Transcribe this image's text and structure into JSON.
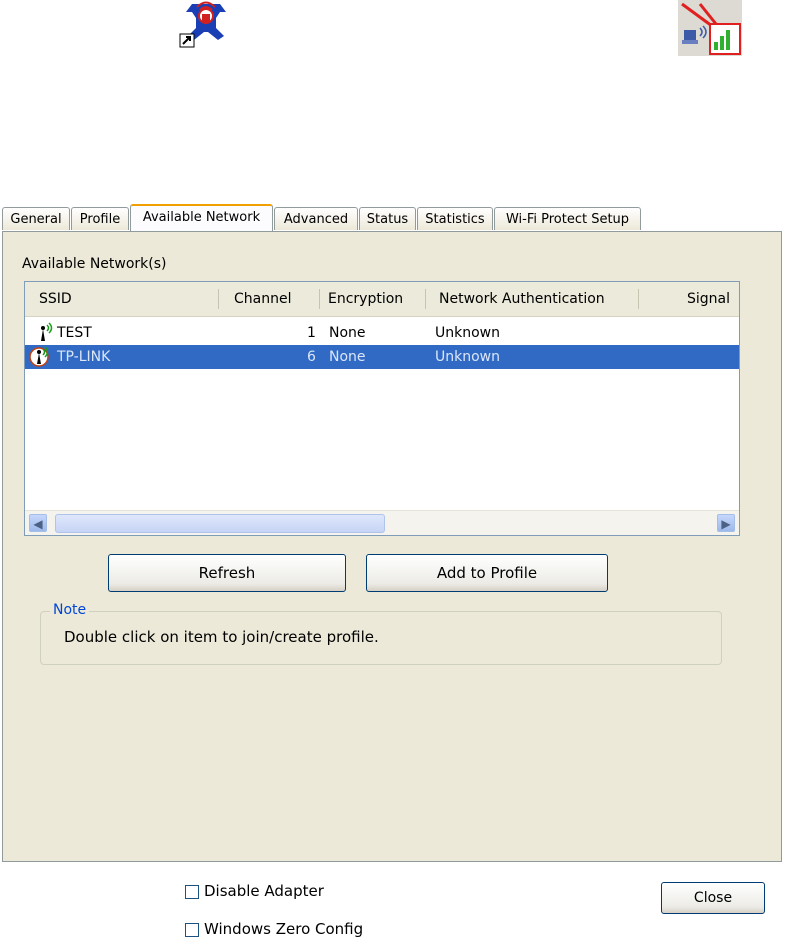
{
  "tabs": [
    {
      "label": "General"
    },
    {
      "label": "Profile"
    },
    {
      "label": "Available Network"
    },
    {
      "label": "Advanced"
    },
    {
      "label": "Status"
    },
    {
      "label": "Statistics"
    },
    {
      "label": "Wi-Fi Protect Setup"
    }
  ],
  "available_label": "Available Network(s)",
  "columns": {
    "ssid": "SSID",
    "channel": "Channel",
    "encryption": "Encryption",
    "auth": "Network Authentication",
    "signal": "Signal"
  },
  "networks": [
    {
      "ssid": "TEST",
      "channel": "1",
      "encryption": "None",
      "auth": "Unknown",
      "selected": false
    },
    {
      "ssid": "TP-LINK",
      "channel": "6",
      "encryption": "None",
      "auth": "Unknown",
      "selected": true
    }
  ],
  "buttons": {
    "refresh": "Refresh",
    "add_to_profile": "Add to Profile",
    "close": "Close"
  },
  "note": {
    "title": "Note",
    "text": "Double click on item to join/create profile."
  },
  "checkboxes": {
    "disable_adapter": "Disable Adapter",
    "windows_zero_config": "Windows Zero Config"
  },
  "colors": {
    "selection": "#316ac5",
    "tab_active_accent": "#f0a000",
    "panel_bg": "#ece9d8"
  }
}
